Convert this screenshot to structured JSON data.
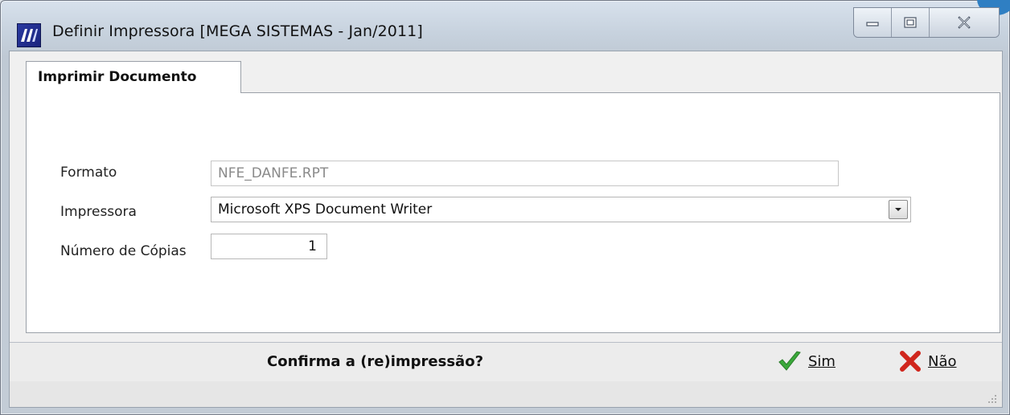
{
  "window": {
    "title": "Definir Impressora [MEGA SISTEMAS - Jan/2011]",
    "icon": "mega-logo-icon",
    "controls": [
      "minimize-icon",
      "maximize-icon",
      "close-icon"
    ]
  },
  "tabs": [
    {
      "label": "Imprimir Documento",
      "active": true
    }
  ],
  "form": {
    "formato": {
      "label": "Formato",
      "value": "NFE_DANFE.RPT",
      "readonly": true
    },
    "impressora": {
      "label": "Impressora",
      "value": "Microsoft XPS Document Writer"
    },
    "copias": {
      "label": "Número de Cópias",
      "value": "1"
    }
  },
  "footer": {
    "question": "Confirma a (re)impressão?",
    "yes": {
      "label": "Sim",
      "icon": "check-icon",
      "color": "#3aa83a"
    },
    "no": {
      "label": "Não",
      "icon": "x-icon",
      "color": "#d0261d"
    }
  },
  "colors": {
    "accent": "#2f7fc3",
    "tab_border": "#9aa0a8"
  }
}
